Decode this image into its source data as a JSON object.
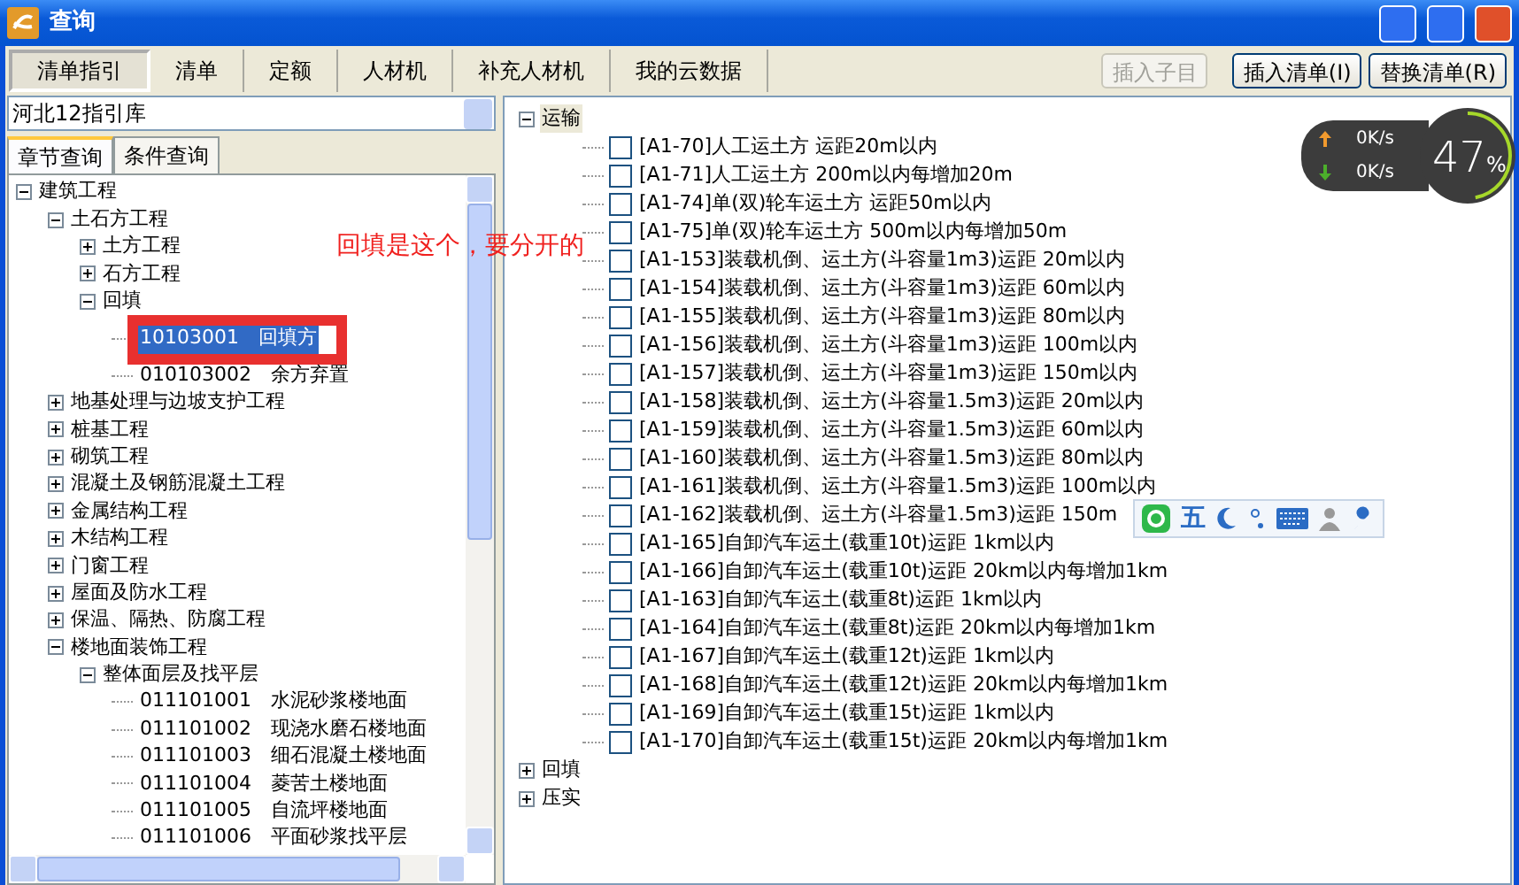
{
  "window": {
    "title": "查询"
  },
  "tabs": [
    {
      "label": "清单指引",
      "selected": true
    },
    {
      "label": "清单",
      "selected": false
    },
    {
      "label": "定额",
      "selected": false
    },
    {
      "label": "人材机",
      "selected": false
    },
    {
      "label": "补充人材机",
      "selected": false
    },
    {
      "label": "我的云数据",
      "selected": false
    }
  ],
  "toolbar_buttons": [
    {
      "label": "插入子目",
      "disabled": true
    },
    {
      "label": "插入清单(I)",
      "disabled": false
    },
    {
      "label": "替换清单(R)",
      "disabled": false
    }
  ],
  "library_select": {
    "value": "河北12指引库"
  },
  "sub_tabs": [
    {
      "label": "章节查询",
      "selected": true
    },
    {
      "label": "条件查询",
      "selected": false
    }
  ],
  "chapter_tree": [
    {
      "label": "建筑工程",
      "expanded": true,
      "children": [
        {
          "label": "土石方工程",
          "expanded": true,
          "children": [
            {
              "label": "土方工程",
              "expanded": false
            },
            {
              "label": "石方工程",
              "expanded": false
            },
            {
              "label": "回填",
              "expanded": true,
              "children": [
                {
                  "code": "10103001",
                  "name": "回填方",
                  "selected": true,
                  "annotated": true
                },
                {
                  "code": "010103002",
                  "name": "余方弃置",
                  "selected": false,
                  "annotated": false
                }
              ]
            }
          ]
        },
        {
          "label": "地基处理与边坡支护工程",
          "expanded": false
        },
        {
          "label": "桩基工程",
          "expanded": false
        },
        {
          "label": "砌筑工程",
          "expanded": false
        },
        {
          "label": "混凝土及钢筋混凝土工程",
          "expanded": false
        },
        {
          "label": "金属结构工程",
          "expanded": false
        },
        {
          "label": "木结构工程",
          "expanded": false
        },
        {
          "label": "门窗工程",
          "expanded": false
        },
        {
          "label": "屋面及防水工程",
          "expanded": false
        },
        {
          "label": "保温、隔热、防腐工程",
          "expanded": false
        },
        {
          "label": "楼地面装饰工程",
          "expanded": true,
          "children": [
            {
              "label": "整体面层及找平层",
              "expanded": true,
              "children": [
                {
                  "code": "011101001",
                  "name": "水泥砂浆楼地面",
                  "selected": false,
                  "annotated": false
                },
                {
                  "code": "011101002",
                  "name": "现浇水磨石楼地面",
                  "selected": false,
                  "annotated": false
                },
                {
                  "code": "011101003",
                  "name": "细石混凝土楼地面",
                  "selected": false,
                  "annotated": false
                },
                {
                  "code": "011101004",
                  "name": "菱苦土楼地面",
                  "selected": false,
                  "annotated": false
                },
                {
                  "code": "011101005",
                  "name": "自流坪楼地面",
                  "selected": false,
                  "annotated": false
                },
                {
                  "code": "011101006",
                  "name": "平面砂浆找平层",
                  "selected": false,
                  "annotated": false
                }
              ]
            }
          ]
        }
      ]
    }
  ],
  "quota_tree": [
    {
      "label": "运输",
      "expanded": true,
      "selected": true,
      "children": [
        {
          "label": "[A1-70]人工运土方 运距20m以内",
          "checked": false
        },
        {
          "label": "[A1-71]人工运土方 200m以内每增加20m",
          "checked": false
        },
        {
          "label": "[A1-74]单(双)轮车运土方 运距50m以内",
          "checked": false
        },
        {
          "label": "[A1-75]单(双)轮车运土方 500m以内每增加50m",
          "checked": false
        },
        {
          "label": "[A1-153]装载机倒、运土方(斗容量1m3)运距 20m以内",
          "checked": false
        },
        {
          "label": "[A1-154]装载机倒、运土方(斗容量1m3)运距 60m以内",
          "checked": false
        },
        {
          "label": "[A1-155]装载机倒、运土方(斗容量1m3)运距 80m以内",
          "checked": false
        },
        {
          "label": "[A1-156]装载机倒、运土方(斗容量1m3)运距 100m以内",
          "checked": false
        },
        {
          "label": "[A1-157]装载机倒、运土方(斗容量1m3)运距 150m以内",
          "checked": false
        },
        {
          "label": "[A1-158]装载机倒、运土方(斗容量1.5m3)运距 20m以内",
          "checked": false
        },
        {
          "label": "[A1-159]装载机倒、运土方(斗容量1.5m3)运距 60m以内",
          "checked": false
        },
        {
          "label": "[A1-160]装载机倒、运土方(斗容量1.5m3)运距 80m以内",
          "checked": false
        },
        {
          "label": "[A1-161]装载机倒、运土方(斗容量1.5m3)运距 100m以内",
          "checked": false
        },
        {
          "label": "[A1-162]装载机倒、运土方(斗容量1.5m3)运距 150m",
          "checked": false
        },
        {
          "label": "[A1-165]自卸汽车运土(载重10t)运距 1km以内",
          "checked": false
        },
        {
          "label": "[A1-166]自卸汽车运土(载重10t)运距 20km以内每增加1km",
          "checked": false
        },
        {
          "label": "[A1-163]自卸汽车运土(载重8t)运距 1km以内",
          "checked": false
        },
        {
          "label": "[A1-164]自卸汽车运土(载重8t)运距 20km以内每增加1km",
          "checked": false
        },
        {
          "label": "[A1-167]自卸汽车运土(载重12t)运距 1km以内",
          "checked": false
        },
        {
          "label": "[A1-168]自卸汽车运土(载重12t)运距 20km以内每增加1km",
          "checked": false
        },
        {
          "label": "[A1-169]自卸汽车运土(载重15t)运距 1km以内",
          "checked": false
        },
        {
          "label": "[A1-170]自卸汽车运土(载重15t)运距 20km以内每增加1km",
          "checked": false
        }
      ]
    },
    {
      "label": "回填",
      "expanded": false,
      "selected": false
    },
    {
      "label": "压实",
      "expanded": false,
      "selected": false
    }
  ],
  "annotation": {
    "text": "回填是这个，要分开的"
  },
  "network_widget": {
    "upload": "0K/s",
    "download": "0K/s",
    "percent": "47",
    "unit": "%",
    "level": 0.47
  },
  "ime_toolbar": {
    "mode": "五"
  }
}
